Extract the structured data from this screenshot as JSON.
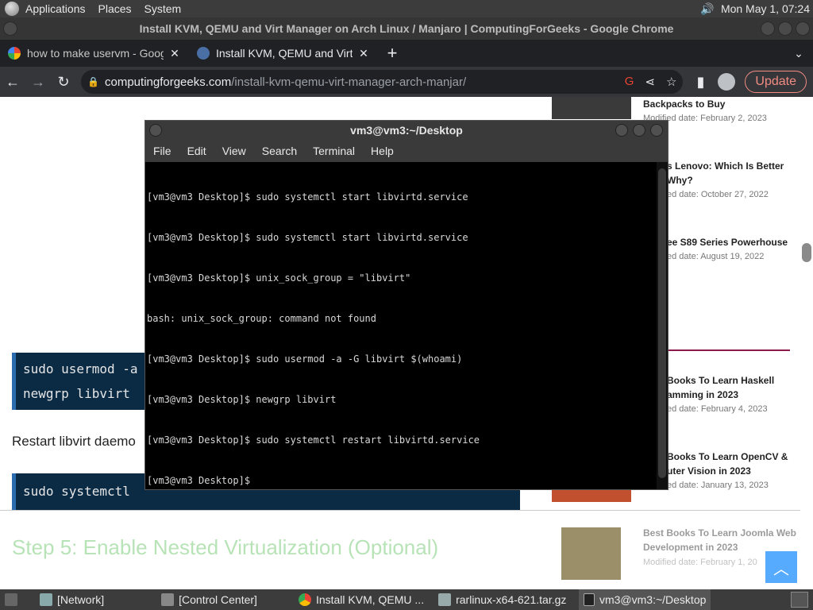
{
  "top_panel": {
    "menus": [
      "Applications",
      "Places",
      "System"
    ],
    "clock": "Mon May  1, 07:24"
  },
  "chrome": {
    "window_title": "Install KVM, QEMU and Virt Manager on Arch Linux / Manjaro | ComputingForGeeks - Google Chrome",
    "tabs": [
      {
        "title": "how to make uservm - Google",
        "favicon": "google-icon"
      },
      {
        "title": "Install KVM, QEMU and Virt M",
        "favicon": "site-icon"
      }
    ],
    "url_domain": "computingforgeeks.com",
    "url_path": "/install-kvm-qemu-virt-manager-arch-manjar/",
    "update_label": "Update"
  },
  "page": {
    "code_block_1": [
      "sudo usermod -a",
      "newgrp libvirt"
    ],
    "restart_text": "Restart libvirt daemo",
    "code_block_2": [
      "sudo systemctl"
    ],
    "step_heading": "Step 5: Enable Nested Virtualization (Optional)",
    "sidebar": [
      {
        "title": "Backpacks to Buy",
        "date": "Modified date: February 2, 2023"
      },
      {
        "title": "s Lenovo: Which Is Better\nWhy?",
        "date": "ed date: October 27, 2022"
      },
      {
        "title": "ee S89 Series Powerhouse",
        "date": "ed date: August 19, 2022"
      },
      {
        "title": "Books To Learn Haskell\namming in 2023",
        "date": "ed date: February 4, 2023"
      },
      {
        "title": "Books To Learn OpenCV &\nuter Vision in 2023",
        "date": "ed date: January 13, 2023"
      },
      {
        "title": "Best Books To Learn Joomla Web\nDevelopment in 2023",
        "date": "Modified date: February 1, 20"
      }
    ]
  },
  "terminal": {
    "title": "vm3@vm3:~/Desktop",
    "menus": [
      "File",
      "Edit",
      "View",
      "Search",
      "Terminal",
      "Help"
    ],
    "lines": [
      "[vm3@vm3 Desktop]$ sudo systemctl start libvirtd.service",
      "[vm3@vm3 Desktop]$ sudo systemctl start libvirtd.service",
      "[vm3@vm3 Desktop]$ unix_sock_group = \"libvirt\"",
      "bash: unix_sock_group: command not found",
      "[vm3@vm3 Desktop]$ sudo usermod -a -G libvirt $(whoami)",
      "[vm3@vm3 Desktop]$ newgrp libvirt",
      "[vm3@vm3 Desktop]$ sudo systemctl restart libvirtd.service",
      "[vm3@vm3 Desktop]$ "
    ]
  },
  "taskbar": {
    "items": [
      "[Network]",
      "[Control Center]",
      "Install KVM, QEMU ...",
      "rarlinux-x64-621.tar.gz",
      "vm3@vm3:~/Desktop"
    ]
  }
}
